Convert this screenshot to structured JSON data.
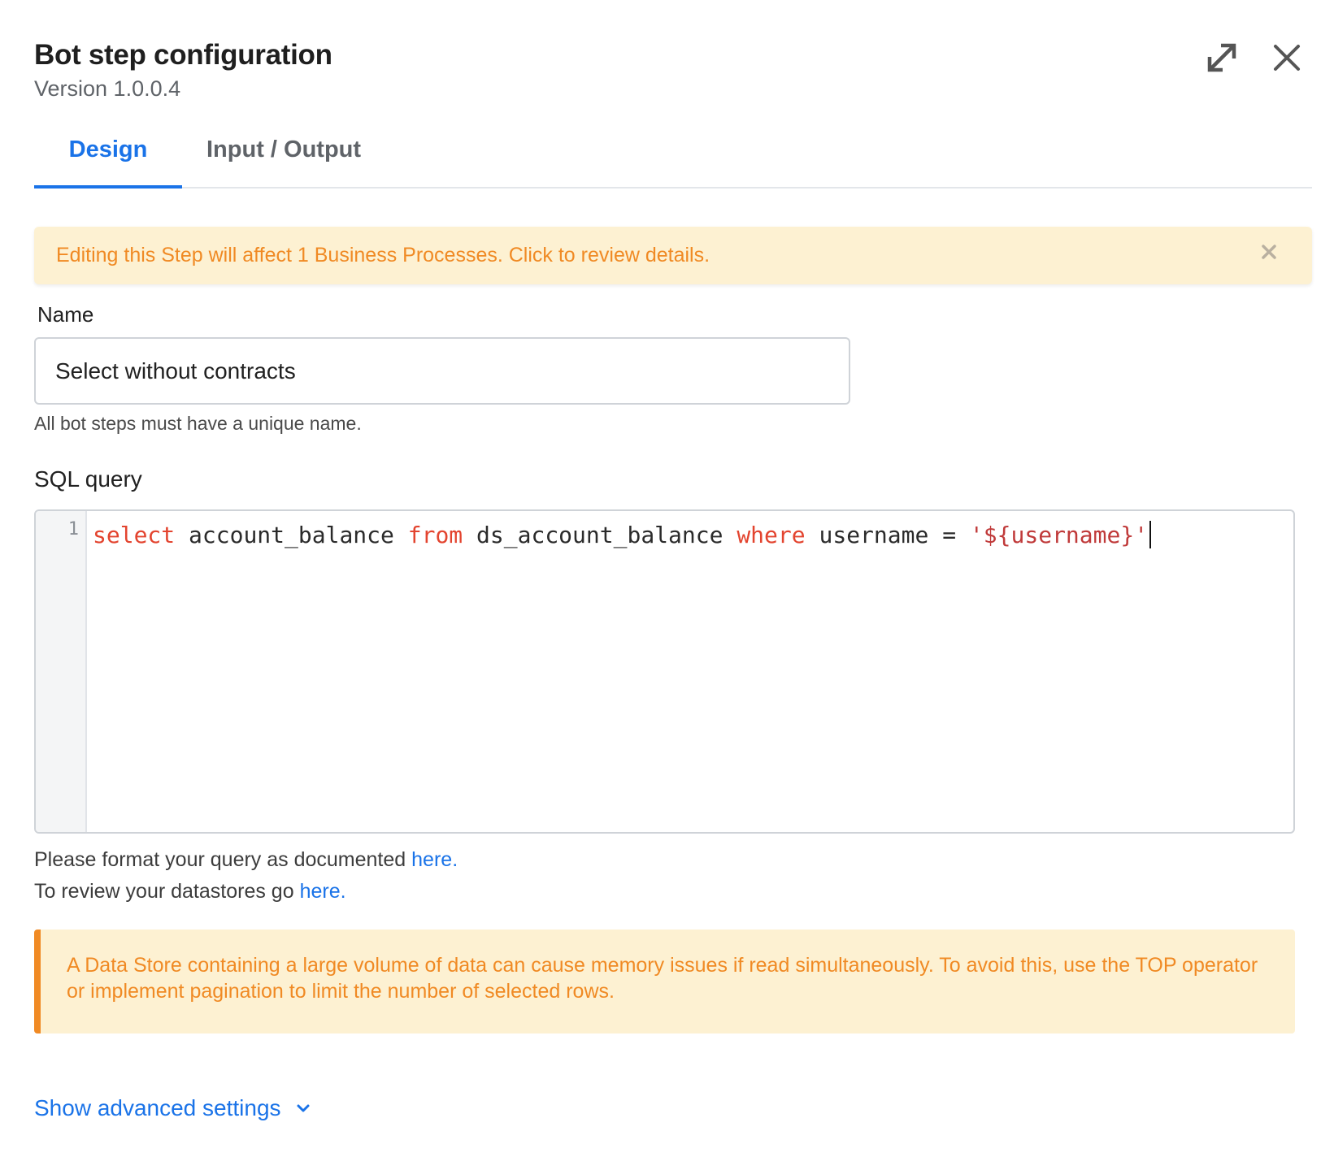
{
  "header": {
    "title": "Bot step configuration",
    "version": "Version 1.0.0.4",
    "expand_icon": "expand-icon",
    "close_icon": "close-icon"
  },
  "tabs": [
    {
      "label": "Design",
      "active": true
    },
    {
      "label": "Input / Output",
      "active": false
    }
  ],
  "banner": {
    "text": "Editing this Step will affect 1 Business Processes. Click to review details.",
    "close_icon": "close-icon"
  },
  "name_field": {
    "label": "Name",
    "value": "Select without contracts",
    "hint": "All bot steps must have a unique name."
  },
  "sql_field": {
    "label": "SQL query",
    "line_number": "1",
    "tokens": {
      "select": "select",
      "part1": " account_balance ",
      "from": "from",
      "part2": " ds_account_balance ",
      "where": "where",
      "part3": " username = ",
      "string": "'${username}'"
    }
  },
  "help": {
    "line1_text": "Please format your query as documented ",
    "line1_link": "here",
    "line1_end": ".",
    "line2_text": "To review your datastores go ",
    "line2_link": "here",
    "line2_end": "."
  },
  "warning": {
    "text": "A Data Store containing a large volume of data can cause memory issues if read simultaneously. To avoid this, use the TOP operator or implement pagination to limit the number of selected rows."
  },
  "advanced": {
    "label": "Show advanced settings",
    "icon": "chevron-down-icon"
  },
  "colors": {
    "accent": "#1a73e8",
    "warning_text": "#f08a24",
    "warning_bg": "#fdf1d2",
    "keyword": "#e3442f",
    "string": "#c03a3a"
  }
}
